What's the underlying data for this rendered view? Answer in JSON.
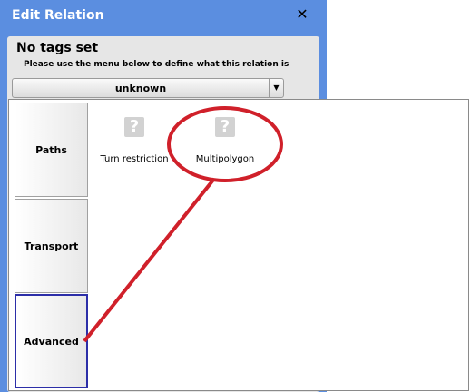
{
  "dialog": {
    "title": "Edit Relation",
    "close_glyph": "✕",
    "heading": "No tags set",
    "instruction": "Please use the menu below to define what this relation is",
    "type_select": {
      "value": "unknown",
      "arrow_glyph": "▼"
    }
  },
  "palette": {
    "tabs": [
      {
        "label": "Paths",
        "active": false
      },
      {
        "label": "Transport",
        "active": false
      },
      {
        "label": "Advanced",
        "active": true
      }
    ],
    "presets": [
      {
        "label": "Turn restriction",
        "icon": "question-icon",
        "glyph": "?"
      },
      {
        "label": "Multipolygon",
        "icon": "question-icon",
        "glyph": "?"
      }
    ]
  },
  "colors": {
    "titlebar": "#5b8ee0",
    "annotation": "#d0202a",
    "active_tab_border": "#2c2ea8"
  }
}
